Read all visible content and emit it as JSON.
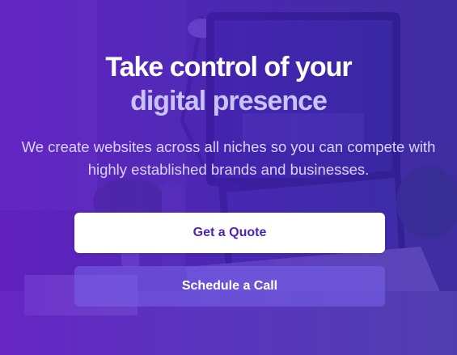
{
  "hero": {
    "headline_line1": "Take control of your",
    "headline_line2": "digital presence",
    "subtext": "We create websites across all niches so you can compete with highly established brands and businesses.",
    "primary_button": "Get a Quote",
    "secondary_button": "Schedule a Call"
  },
  "colors": {
    "overlay": "#4a1ec0",
    "headline_accent": "#c7c2f7",
    "primary_button_text": "#4a25b8"
  }
}
